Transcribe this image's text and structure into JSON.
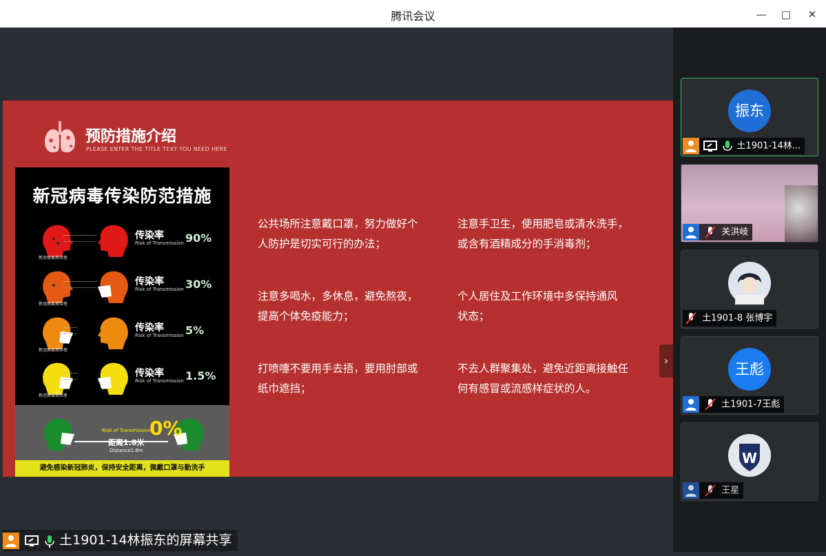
{
  "window": {
    "title": "腾讯会议",
    "min_icon": "minimize-icon",
    "max_icon": "maximize-icon",
    "close_icon": "close-icon"
  },
  "slide": {
    "title": "预防措施介绍",
    "subtitle": "PLEASE ENTER THE TITLE TEXT YOU NEED HERE",
    "poster": {
      "title": "新冠病毒传染防范措施",
      "rows": [
        {
          "label_cn": "传染率",
          "label_en": "Risk of Transmission",
          "value": "90%",
          "caption": "新冠病毒携带者"
        },
        {
          "label_cn": "传染率",
          "label_en": "Risk of Transmission",
          "value": "30%",
          "caption": "新冠病毒携带者"
        },
        {
          "label_cn": "传染率",
          "label_en": "Risk of Transmission",
          "value": "5%",
          "caption": "新冠病毒携带者"
        },
        {
          "label_cn": "传染率",
          "label_en": "Risk of Transmission",
          "value": "1.5%",
          "caption": "新冠病毒携带者"
        }
      ],
      "bottom_risk": "Risk of Transmission",
      "bottom_value": "0%",
      "distance_cn": "距离1.8米",
      "distance_en": "Distance1.8m",
      "footer": "避免感染新冠肺炎，保持安全距离，佩戴口罩与勤洗手"
    },
    "tips": [
      "公共场所注意戴口罩，努力做好个人防护是切实可行的办法；",
      "注意手卫生，使用肥皂或清水洗手，或含有酒精成分的手消毒剂；",
      "注意多喝水，多休息，避免熬夜，提高个体免疫能力；",
      "个人居住及工作环境中多保持通风状态；",
      "打喷嚏不要用手去捂，要用肘部或纸巾遮挡；",
      "不去人群聚集处，避免近距离接触任何有感冒或流感样症状的人。"
    ]
  },
  "share_bar": {
    "text": "土1901-14林振东的屏幕共享"
  },
  "participants": [
    {
      "avatar_text": "振东",
      "name": "土1901-14林...",
      "avatar_color": "#1f6fd6",
      "sharing": true,
      "muted": false
    },
    {
      "avatar_text": "",
      "name": "关洪岐",
      "avatar_color": "#c9a3b8",
      "sharing": false,
      "muted": true
    },
    {
      "avatar_text": "",
      "name": "土1901-8 张博宇",
      "avatar_color": "#cfd6de",
      "sharing": false,
      "muted": true
    },
    {
      "avatar_text": "王彪",
      "name": "土1901-7王彪",
      "avatar_color": "#1a7cf0",
      "sharing": false,
      "muted": true
    },
    {
      "avatar_text": "W",
      "name": "王星",
      "avatar_color": "#d8dbe0",
      "sharing": false,
      "muted": true
    }
  ],
  "colors": {
    "slide_bg": "#b5302e",
    "accent_green": "#3bb46b",
    "host_orange": "#f08c1e"
  }
}
